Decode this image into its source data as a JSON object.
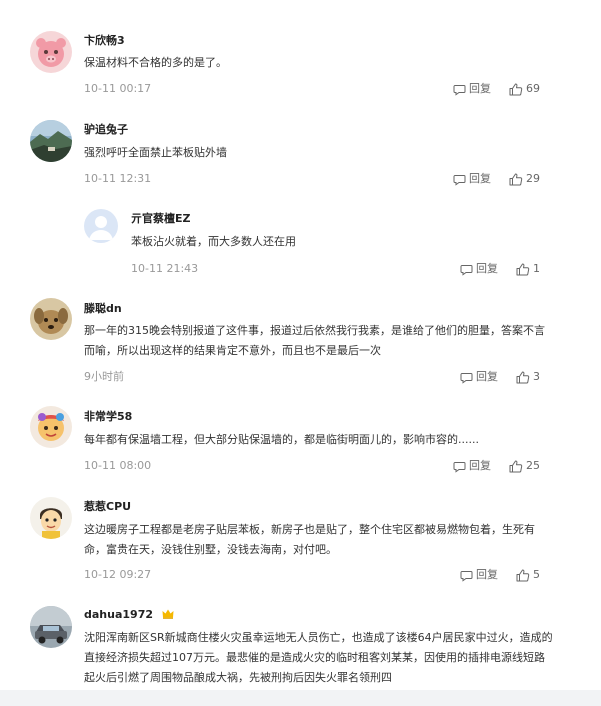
{
  "comments": [
    {
      "name": "卞欣畅3",
      "text": "保温材料不合格的多的是了。",
      "time": "10-11 00:17",
      "reply_label": "回复",
      "likes": "69",
      "avatar_icon": "pink-cartoon-animal-avatar"
    },
    {
      "name": "驴追兔子",
      "text": "强烈呼吁全面禁止苯板贴外墙",
      "time": "10-11 12:31",
      "reply_label": "回复",
      "likes": "29",
      "avatar_icon": "landscape-photo-avatar"
    },
    {
      "name": "亓官蔡檀EZ",
      "text": "苯板沾火就着，而大多数人还在用",
      "time": "10-11 21:43",
      "reply_label": "回复",
      "likes": "1",
      "avatar_icon": "default-user-avatar"
    },
    {
      "name": "滕聪dn",
      "text": "那一年的315晚会特别报道了这件事，报道过后依然我行我素，是谁给了他们的胆量，答案不言而喻，所以出现这样的结果肯定不意外，而且也不是最后一次",
      "time": "9小时前",
      "reply_label": "回复",
      "likes": "3",
      "avatar_icon": "dog-photo-avatar"
    },
    {
      "name": "非常学58",
      "text": "每年都有保温墙工程，但大部分贴保温墙的，都是临街明面儿的，影响市容的......",
      "time": "10-11 08:00",
      "reply_label": "回复",
      "likes": "25",
      "avatar_icon": "colorful-cartoon-avatar"
    },
    {
      "name": "惹惹CPU",
      "text": "这边暖房子工程都是老房子贴层苯板，新房子也是贴了，整个住宅区都被易燃物包着，生死有命，富贵在天，没钱住别墅，没钱去海南，对付吧。",
      "time": "10-12 09:27",
      "reply_label": "回复",
      "likes": "5",
      "avatar_icon": "cartoon-character-avatar"
    },
    {
      "name": "dahua1972",
      "text": "沈阳浑南新区SR新城商住楼火灾虽幸运地无人员伤亡，也造成了该楼64户居民家中过火，造成的直接经济损失超过107万元。最悲催的是造成火灾的临时租客刘某某，因使用的插排电源线短路起火后引燃了周围物品酿成大祸，先被刑拘后因失火罪名领刑四",
      "time": "",
      "reply_label": "",
      "likes": "",
      "avatar_icon": "car-photo-avatar",
      "badge_icon": "gold-crown-icon"
    }
  ],
  "colors": {
    "name": "#222222",
    "text": "#333333",
    "meta": "#999999",
    "action": "#666666",
    "bottom_bar": "#f2f3f5",
    "crown": "#f5b800"
  }
}
